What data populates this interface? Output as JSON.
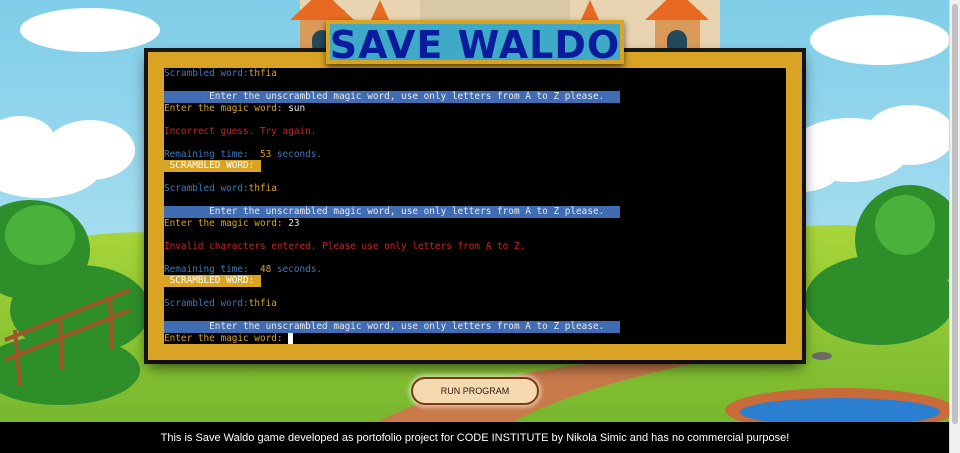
{
  "title": "SAVE WALDO",
  "terminal_lines": [
    {
      "parts": [
        {
          "t": "Scrambled word:",
          "c": "c-blue"
        },
        {
          "t": "thfia",
          "c": "c-orange"
        }
      ]
    },
    {
      "parts": []
    },
    {
      "parts": [
        {
          "t": "        Enter the unscrambled magic word, use only letters from A to Z please.",
          "c": "prompt-bar"
        }
      ]
    },
    {
      "parts": [
        {
          "t": "Enter the magic word: ",
          "c": "c-orange"
        },
        {
          "t": "sun",
          "c": "c-white"
        }
      ]
    },
    {
      "parts": []
    },
    {
      "parts": [
        {
          "t": "Incorrect guess. Try again.",
          "c": "c-red"
        }
      ]
    },
    {
      "parts": []
    },
    {
      "parts": [
        {
          "t": "Remaining time:  ",
          "c": "c-blue"
        },
        {
          "t": "53",
          "c": "c-orange"
        },
        {
          "t": " seconds.",
          "c": "c-blue"
        }
      ]
    },
    {
      "parts": [
        {
          "t": " SCRAMBLED WORD:",
          "c": "scr-badge"
        }
      ]
    },
    {
      "parts": []
    },
    {
      "parts": [
        {
          "t": "Scrambled word:",
          "c": "c-blue"
        },
        {
          "t": "thfia",
          "c": "c-orange"
        }
      ]
    },
    {
      "parts": []
    },
    {
      "parts": [
        {
          "t": "        Enter the unscrambled magic word, use only letters from A to Z please.",
          "c": "prompt-bar"
        }
      ]
    },
    {
      "parts": [
        {
          "t": "Enter the magic word: ",
          "c": "c-orange"
        },
        {
          "t": "23",
          "c": "c-white"
        }
      ]
    },
    {
      "parts": []
    },
    {
      "parts": [
        {
          "t": "Invalid characters entered. Please use only letters from A to Z.",
          "c": "c-red"
        }
      ]
    },
    {
      "parts": []
    },
    {
      "parts": [
        {
          "t": "Remaining time:  ",
          "c": "c-blue"
        },
        {
          "t": "48",
          "c": "c-orange"
        },
        {
          "t": " seconds.",
          "c": "c-blue"
        }
      ]
    },
    {
      "parts": [
        {
          "t": " SCRAMBLED WORD:",
          "c": "scr-badge"
        }
      ]
    },
    {
      "parts": []
    },
    {
      "parts": [
        {
          "t": "Scrambled word:",
          "c": "c-blue"
        },
        {
          "t": "thfia",
          "c": "c-orange"
        }
      ]
    },
    {
      "parts": []
    },
    {
      "parts": [
        {
          "t": "        Enter the unscrambled magic word, use only letters from A to Z please.",
          "c": "prompt-bar"
        }
      ]
    },
    {
      "parts": [
        {
          "t": "Enter the magic word: ",
          "c": "c-orange"
        }
      ],
      "cursor": true
    }
  ],
  "run_button": "RUN PROGRAM",
  "footer": "This is Save Waldo game developed as portofolio project for CODE INSTITUTE by Nikola Simic and has no commercial purpose!",
  "colors": {
    "accent": "#d9a424",
    "title": "#0a1c9c",
    "prompt_bar": "#3f6cb3",
    "error": "#d02020"
  }
}
